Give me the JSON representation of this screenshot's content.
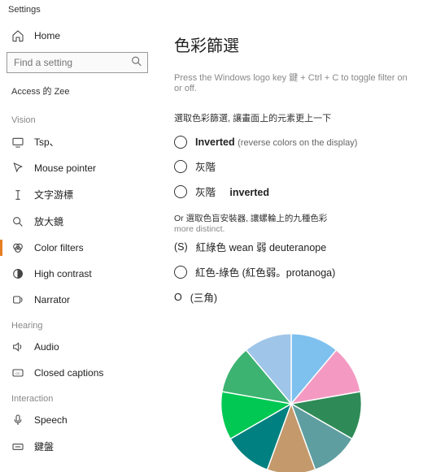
{
  "window": {
    "title": "Settings"
  },
  "sidebar": {
    "home": "Home",
    "search_placeholder": "Find a setting",
    "breadcrumb": "Access 的 Zee",
    "groups": {
      "vision": "Vision",
      "hearing": "Hearing",
      "interaction": "Interaction"
    },
    "items": {
      "tsp": "Tsp、",
      "mouse_pointer": "Mouse pointer",
      "text_cursor": "文字游標",
      "magnifier": "放大鏡",
      "color_filters": "Color filters",
      "high_contrast": "High contrast",
      "narrator": "Narrator",
      "audio": "Audio",
      "closed_captions": "Closed captions",
      "speech": "Speech",
      "keyboard": "鍵盤"
    }
  },
  "page": {
    "title": "色彩篩選",
    "hint": "Press the Windows logo key 鍵 + Ctrl + C to toggle filter on or off.",
    "sub1": "選取色彩篩選, 讓畫面上的元素更上一下",
    "radios": {
      "inverted_label": "Inverted",
      "inverted_desc": "(reverse colors on the display)",
      "grayscale": "灰階",
      "grayscale_inverted_a": "灰階",
      "grayscale_inverted_b": "inverted",
      "deut_prefix": "(S)",
      "deut": "紅綠色 wean 弱 deuteranope",
      "prot": "紅色-綠色 (紅色弱。protanoga)",
      "trit_prefix": "O",
      "trit": "(三角)"
    },
    "sub2a": "Or 選取色盲安裝器, 讓螺輪上的九種色彩",
    "sub2b": "more distinct."
  },
  "chart_data": {
    "type": "pie",
    "title": "",
    "values": [
      1,
      1,
      1,
      1,
      1,
      1,
      1,
      1,
      1
    ],
    "colors": [
      "#7ec0ee",
      "#f49ac2",
      "#2e8b57",
      "#5f9ea0",
      "#c49a6c",
      "#008080",
      "#00c853",
      "#3cb371",
      "#9fc5e8"
    ]
  }
}
